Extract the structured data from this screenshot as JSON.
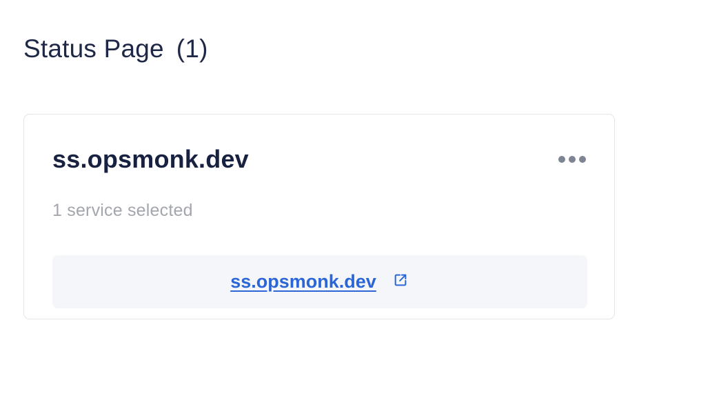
{
  "header": {
    "title": "Status Page",
    "count": "(1)"
  },
  "status_pages": [
    {
      "title": "ss.opsmonk.dev",
      "subtitle": "1 service selected",
      "link_text": "ss.opsmonk.dev",
      "more_icon": "more-horizontal-icon",
      "link_icon": "external-link-icon"
    }
  ],
  "colors": {
    "heading": "#1e2745",
    "card_title": "#18213f",
    "muted": "#a3a6ad",
    "link": "#2c65d6",
    "link_bg": "#f4f6fa",
    "card_border": "#e3e5ea",
    "dots": "#7d8493"
  }
}
